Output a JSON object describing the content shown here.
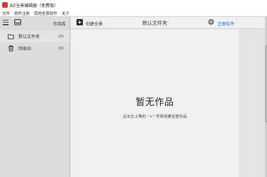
{
  "window": {
    "title": "BZ全景编辑器（免费版）"
  },
  "menu": [
    "文件",
    "软件注册",
    "其他全景软件",
    "关于"
  ],
  "sidebar": {
    "title": "作品库",
    "items": [
      {
        "label": "默认文件夹",
        "count": "(0)",
        "icon": "folder-icon"
      },
      {
        "label": "回收站",
        "count": "(0)",
        "icon": "trash-icon"
      }
    ]
  },
  "toolbar": {
    "create_label": "创建全景",
    "folder_title": "默认文件夹",
    "register_label": "注册软件"
  },
  "empty": {
    "title": "暂无作品",
    "hint": "点击左上角的 “+” 号来创建全景作品"
  },
  "colors": {
    "link": "#2a6ad0",
    "app_icon": "#d43a2f"
  }
}
